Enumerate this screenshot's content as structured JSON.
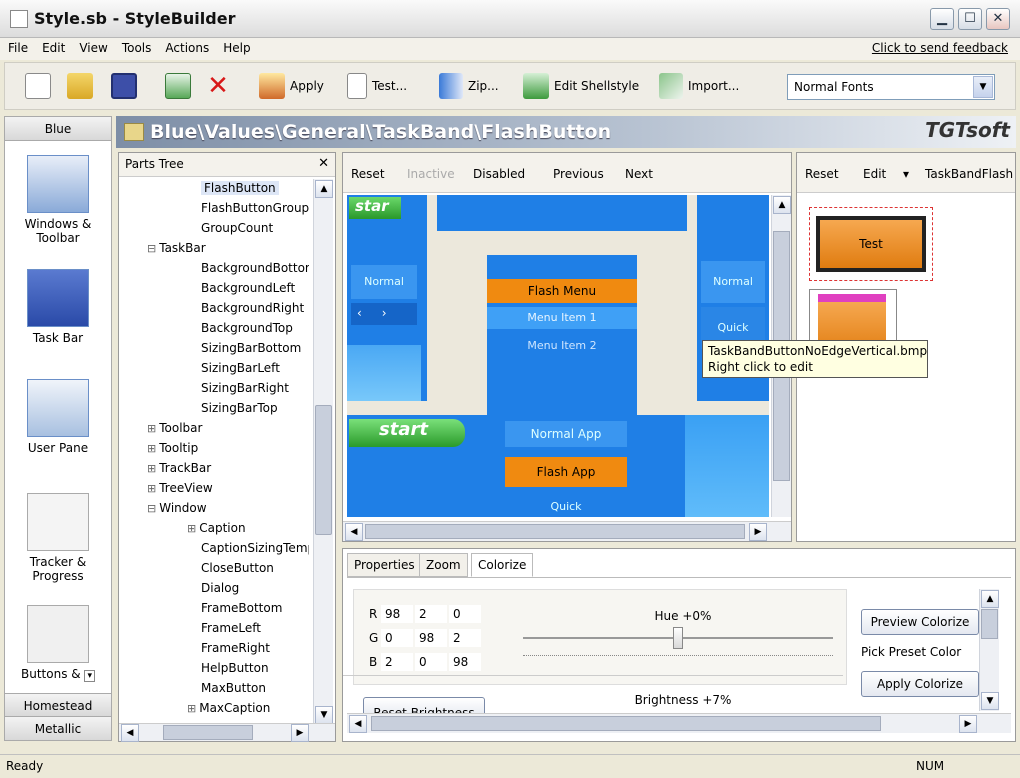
{
  "window": {
    "title": "Style.sb - StyleBuilder",
    "min": "▁",
    "max": "☐",
    "close": "✕"
  },
  "menu": [
    "File",
    "Edit",
    "View",
    "Tools",
    "Actions",
    "Help"
  ],
  "feedback_link": "Click to send feedback",
  "toolbar": {
    "apply": "Apply",
    "test": "Test...",
    "zip": "Zip...",
    "edit_shellstyle": "Edit Shellstyle",
    "import": "Import...",
    "font_select": "Normal Fonts"
  },
  "left_sidebar": {
    "top_header": "Blue",
    "items": [
      "Windows & Toolbar",
      "Task Bar",
      "User Pane",
      "Tracker & Progress",
      "Buttons &"
    ],
    "bottom_headers": [
      "Homestead",
      "Metallic"
    ]
  },
  "path": "Blue\\Values\\General\\TaskBand\\FlashButton",
  "logo": "TGTsoft",
  "parts_tree": {
    "header": "Parts Tree",
    "rows": [
      {
        "label": "FlashButton",
        "level": 2,
        "toggle": "",
        "selected": true
      },
      {
        "label": "FlashButtonGroupf",
        "level": 2,
        "toggle": ""
      },
      {
        "label": "GroupCount",
        "level": 2,
        "toggle": ""
      },
      {
        "label": "TaskBar",
        "level": 1,
        "toggle": "⊟"
      },
      {
        "label": "BackgroundBottom",
        "level": 2,
        "toggle": ""
      },
      {
        "label": "BackgroundLeft",
        "level": 2,
        "toggle": ""
      },
      {
        "label": "BackgroundRight",
        "level": 2,
        "toggle": ""
      },
      {
        "label": "BackgroundTop",
        "level": 2,
        "toggle": ""
      },
      {
        "label": "SizingBarBottom",
        "level": 2,
        "toggle": ""
      },
      {
        "label": "SizingBarLeft",
        "level": 2,
        "toggle": ""
      },
      {
        "label": "SizingBarRight",
        "level": 2,
        "toggle": ""
      },
      {
        "label": "SizingBarTop",
        "level": 2,
        "toggle": ""
      },
      {
        "label": "Toolbar",
        "level": 1,
        "toggle": "⊞"
      },
      {
        "label": "Tooltip",
        "level": 1,
        "toggle": "⊞"
      },
      {
        "label": "TrackBar",
        "level": 1,
        "toggle": "⊞"
      },
      {
        "label": "TreeView",
        "level": 1,
        "toggle": "⊞"
      },
      {
        "label": "Window",
        "level": 1,
        "toggle": "⊟"
      },
      {
        "label": "Caption",
        "level": 2,
        "toggle": "⊞"
      },
      {
        "label": "CaptionSizingTemp",
        "level": 2,
        "toggle": ""
      },
      {
        "label": "CloseButton",
        "level": 2,
        "toggle": ""
      },
      {
        "label": "Dialog",
        "level": 2,
        "toggle": ""
      },
      {
        "label": "FrameBottom",
        "level": 2,
        "toggle": ""
      },
      {
        "label": "FrameLeft",
        "level": 2,
        "toggle": ""
      },
      {
        "label": "FrameRight",
        "level": 2,
        "toggle": ""
      },
      {
        "label": "HelpButton",
        "level": 2,
        "toggle": ""
      },
      {
        "label": "MaxButton",
        "level": 2,
        "toggle": ""
      },
      {
        "label": "MaxCaption",
        "level": 2,
        "toggle": "⊞"
      }
    ]
  },
  "preview_toolbar": [
    "Reset",
    "Inactive",
    "Disabled",
    "Previous",
    "Next"
  ],
  "preview": {
    "start_small": "star",
    "start": "start",
    "normal": "Normal",
    "normal_right": "Normal",
    "quick": "Quick",
    "quick_bottom": "Quick",
    "flash_menu": "Flash Menu",
    "menu_item1": "Menu Item 1",
    "menu_item2": "Menu Item 2",
    "normal_app": "Normal App",
    "flash_app": "Flash App"
  },
  "right_toolbar": {
    "reset": "Reset",
    "edit": "Edit",
    "edit_arrow": "▾",
    "name": "TaskBandFlash"
  },
  "right_preview": {
    "test_label": "Test"
  },
  "tooltip": {
    "line1": "TaskBandButtonNoEdgeVertical.bmp",
    "line2": "Right click to edit"
  },
  "bottom_tabs": [
    "Properties",
    "Zoom",
    "Colorize"
  ],
  "colorize": {
    "rows": [
      {
        "label": "R",
        "v": [
          "98",
          "2",
          "0"
        ]
      },
      {
        "label": "G",
        "v": [
          "0",
          "98",
          "2"
        ]
      },
      {
        "label": "B",
        "v": [
          "2",
          "0",
          "98"
        ]
      }
    ],
    "hue_label": "Hue +0%",
    "hue_value": 0.5,
    "brightness_label": "Brightness +7%",
    "reset_brightness": "Reset Brightness",
    "preview_colorize": "Preview Colorize",
    "pick_preset": "Pick Preset Color",
    "apply_colorize": "Apply Colorize"
  },
  "status": {
    "left": "Ready",
    "right": "NUM"
  },
  "colors": {
    "blue": "#1f7fe6",
    "orange": "#f08a10",
    "green": "#3cb83c"
  }
}
